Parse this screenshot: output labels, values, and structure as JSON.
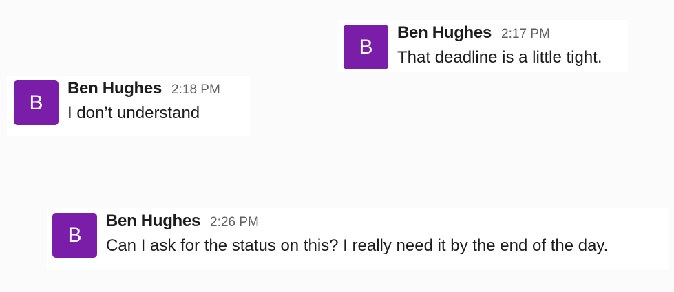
{
  "messages": [
    {
      "avatar_letter": "B",
      "author": "Ben Hughes",
      "time": "2:17 PM",
      "text": "That deadline is a little tight."
    },
    {
      "avatar_letter": "B",
      "author": "Ben Hughes",
      "time": "2:18 PM",
      "text": "I don’t understand"
    },
    {
      "avatar_letter": "B",
      "author": "Ben Hughes",
      "time": "2:26 PM",
      "text": "Can I ask for the status on this? I really need it by the end of the day."
    }
  ],
  "colors": {
    "avatar": "#7a1ea9",
    "background": "#fbfbfb",
    "message_background": "#ffffff",
    "timestamp": "#616061"
  }
}
